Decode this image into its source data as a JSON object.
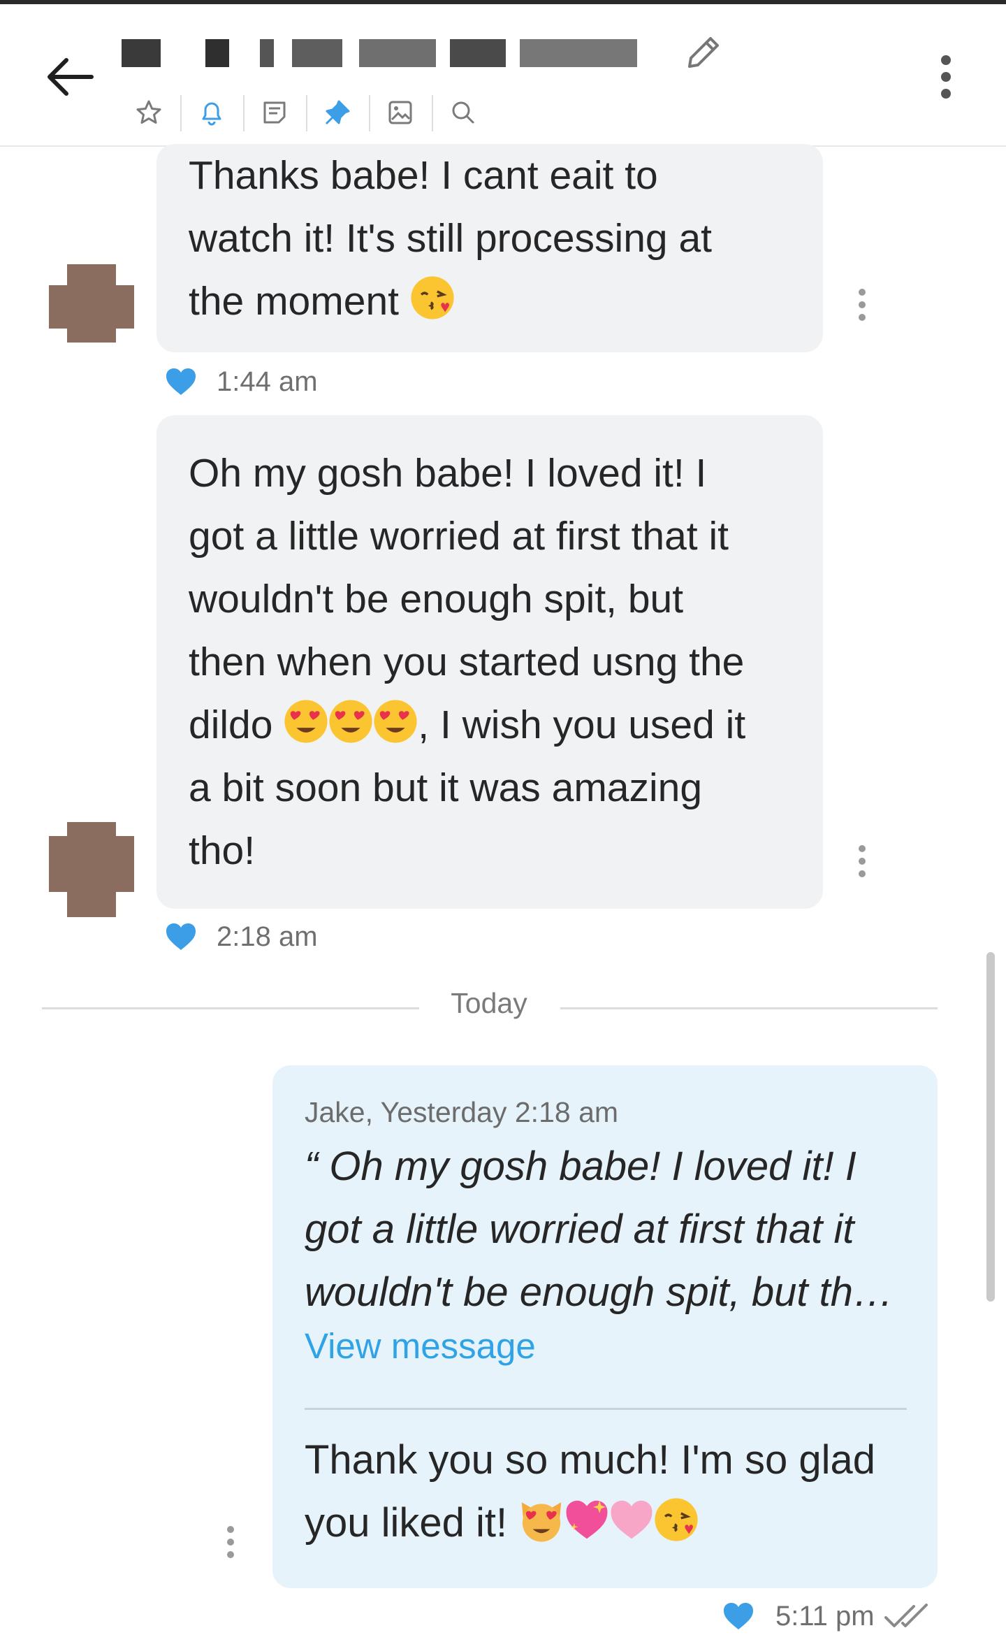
{
  "colors": {
    "accent": "#2fa3e6",
    "heart": "#3b9ee6",
    "incoming_bubble": "#f1f2f4",
    "outgoing_bubble": "#e6f3fb"
  },
  "header": {
    "back_icon": "arrow-left-icon",
    "edit_icon": "pencil-icon",
    "more_icon": "kebab-vertical-icon",
    "toolbar": [
      "star-icon",
      "bell-icon",
      "note-icon",
      "pin-icon",
      "image-icon",
      "search-icon"
    ]
  },
  "messages": [
    {
      "lines": [
        "Thanks babe! I cant eait to",
        "watch it! It's still processing at",
        "the moment"
      ],
      "emoji": [
        "kiss"
      ],
      "time": "1:44 am"
    },
    {
      "lines": [
        "Oh my gosh babe! I loved it! I",
        "got a little worried at first that it",
        "wouldn't be enough spit, but",
        "then when you started usng the",
        "dildo",
        ", I wish you used it",
        "a bit soon but it was amazing",
        "tho!"
      ],
      "emoji": [
        "heart-eyes",
        "heart-eyes",
        "heart-eyes"
      ],
      "time": "2:18 am"
    }
  ],
  "divider": {
    "label": "Today"
  },
  "reply": {
    "quote_author": "Jake, Yesterday 2:18 am",
    "quote_lines": [
      "“ Oh my gosh babe! I loved it! I",
      "got a little worried at first that it",
      "wouldn't be enough spit, but th…"
    ],
    "view_link": "View message",
    "text_lines": [
      "Thank you so much! I'm so glad",
      "you liked it!"
    ],
    "emoji": [
      "heart-eyes-cat",
      "sparkling-heart",
      "pink-heart",
      "kiss"
    ],
    "time": "5:11 pm"
  }
}
